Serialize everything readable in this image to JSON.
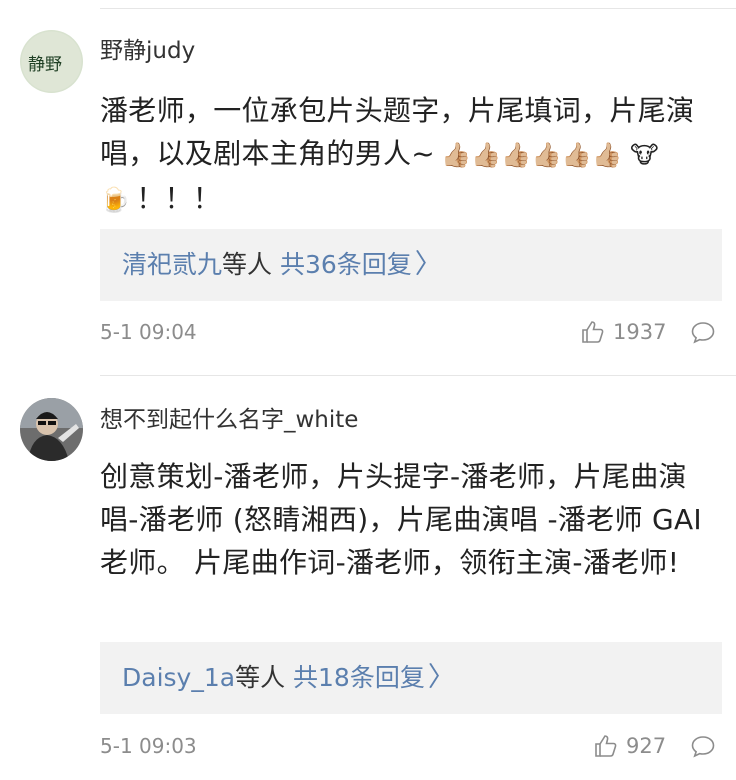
{
  "comments": [
    {
      "avatar_text": "静野",
      "username": "野静judy",
      "content": "潘老师，一位承包片头题字，片尾填词，片尾演唱，以及剧本主角的男人~",
      "emojis": "👍🏼👍🏼👍🏼👍🏼👍🏼👍🏼 🐮 🍺",
      "exclaims": "！！！",
      "reply_names": "清祀贰九",
      "reply_mid": "等人",
      "reply_total": "共36条回复",
      "time": "5-1 09:04",
      "likes": "1937"
    },
    {
      "username": "想不到起什么名字_white",
      "content": "创意策划-潘老师，片头提字-潘老师，片尾曲演唱-潘老师 (怒睛湘西)，片尾曲演唱 -潘老师 GAI老师。 片尾曲作词-潘老师，领衔主演-潘老师!",
      "reply_names": "Daisy_1a",
      "reply_mid": "等人",
      "reply_total": "共18条回复",
      "time": "5-1 09:03",
      "likes": "927"
    }
  ],
  "icons": {
    "like": "thumbs-up-outline-icon",
    "comment": "speech-bubble-icon",
    "arrow": "chevron-right-icon"
  },
  "colors": {
    "link": "#5b7fae",
    "reply_bg": "#f2f2f2",
    "meta": "#8c8c8c"
  }
}
